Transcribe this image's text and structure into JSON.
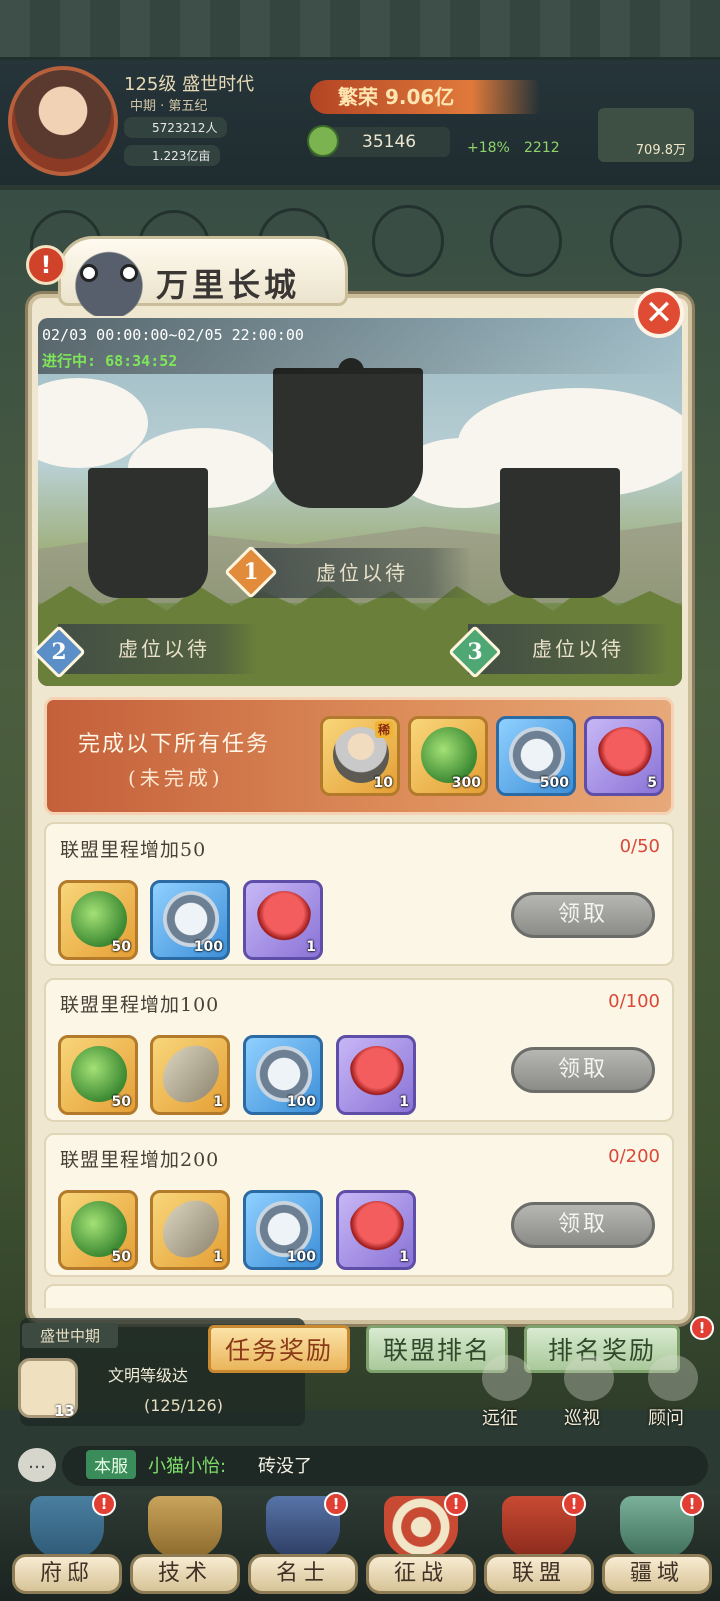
{
  "header": {
    "level_title": "125级 盛世时代",
    "era": "中期 · 第五纪",
    "population": "5723212人",
    "land": "1.223亿亩",
    "prosperity": "繁荣 9.06亿",
    "currency": "35146",
    "bonus_pct": "+18%",
    "bonus_count": "2212",
    "resource_amount": "709.8万"
  },
  "modal": {
    "title": "万里长城",
    "close_icon": "close-icon",
    "time_range": "02/03 00:00:00~02/05 22:00:00",
    "status_label": "进行中:",
    "countdown": "68:34:52",
    "ranks": [
      {
        "num": "1",
        "label": "虚位以待"
      },
      {
        "num": "2",
        "label": "虚位以待"
      },
      {
        "num": "3",
        "label": "虚位以待"
      }
    ],
    "objective": {
      "title": "完成以下所有任务",
      "status": "(未完成)",
      "rewards": [
        {
          "icon": "hero-portrait-icon",
          "qty": "10",
          "tag": "稀"
        },
        {
          "icon": "jade-dragon-icon",
          "qty": "300"
        },
        {
          "icon": "contribution-coin-icon",
          "qty": "500"
        },
        {
          "icon": "rose-icon",
          "qty": "5"
        }
      ]
    },
    "tasks": [
      {
        "title": "联盟里程增加50",
        "progress": "0/50",
        "button": "领取",
        "rewards": [
          {
            "icon": "jade-dragon-icon",
            "qty": "50"
          },
          {
            "icon": "contribution-coin-icon",
            "qty": "100"
          },
          {
            "icon": "rose-icon",
            "qty": "1"
          }
        ]
      },
      {
        "title": "联盟里程增加100",
        "progress": "0/100",
        "button": "领取",
        "rewards": [
          {
            "icon": "jade-dragon-icon",
            "qty": "50"
          },
          {
            "icon": "stone-brick-icon",
            "qty": "1"
          },
          {
            "icon": "contribution-coin-icon",
            "qty": "100"
          },
          {
            "icon": "rose-icon",
            "qty": "1"
          }
        ]
      },
      {
        "title": "联盟里程增加200",
        "progress": "0/200",
        "button": "领取",
        "rewards": [
          {
            "icon": "jade-dragon-icon",
            "qty": "50"
          },
          {
            "icon": "stone-brick-icon",
            "qty": "1"
          },
          {
            "icon": "contribution-coin-icon",
            "qty": "100"
          },
          {
            "icon": "rose-icon",
            "qty": "1"
          }
        ]
      }
    ],
    "tabs": [
      "任务奖励",
      "联盟排名",
      "排名奖励"
    ],
    "active_tab": "任务奖励"
  },
  "civilization": {
    "era": "盛世中期",
    "label": "文明等级达",
    "progress": "(125/126)",
    "badge": "13"
  },
  "side_actions": [
    "远征",
    "巡视",
    "顾问"
  ],
  "chat": {
    "channel": "本服",
    "user": "小猫小怡:",
    "message": "砖没了"
  },
  "nav": [
    "府邸",
    "技术",
    "名士",
    "征战",
    "联盟",
    "疆域"
  ],
  "colors": {
    "accent_red": "#e04b33",
    "status_green": "#7fe65a",
    "progress_red": "#d9493a",
    "tab_active": "#eab55b",
    "tab_inactive": "#a9c99b"
  }
}
